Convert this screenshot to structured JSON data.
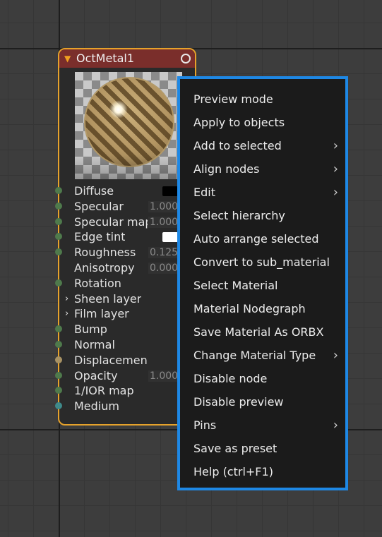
{
  "node": {
    "title": "OctMetal1",
    "pins": [
      {
        "label": "Diffuse",
        "dot": "green",
        "swatch": "#000000"
      },
      {
        "label": "Specular",
        "dot": "green",
        "value": "1.000"
      },
      {
        "label": "Specular map",
        "dot": "green",
        "value": "1.000"
      },
      {
        "label": "Edge tint",
        "dot": "green",
        "swatch": "#ffffff"
      },
      {
        "label": "Roughness",
        "dot": "green",
        "value": "0.125"
      },
      {
        "label": "Anisotropy",
        "dot": "none",
        "value": "0.000"
      },
      {
        "label": "Rotation",
        "dot": "green"
      },
      {
        "label": "Sheen layer",
        "dot": "none",
        "chevron": true
      },
      {
        "label": "Film layer",
        "dot": "none",
        "chevron": true
      },
      {
        "label": "Bump",
        "dot": "green"
      },
      {
        "label": "Normal",
        "dot": "green"
      },
      {
        "label": "Displacement",
        "dot": "tan"
      },
      {
        "label": "Opacity",
        "dot": "green",
        "value": "1.000"
      },
      {
        "label": "1/IOR map",
        "dot": "green"
      },
      {
        "label": "Medium",
        "dot": "teal"
      }
    ]
  },
  "context_menu": {
    "items": [
      {
        "label": "Preview mode"
      },
      {
        "label": "Apply to objects"
      },
      {
        "label": "Add to selected",
        "submenu": true
      },
      {
        "label": "Align nodes",
        "submenu": true
      },
      {
        "label": "Edit",
        "submenu": true
      },
      {
        "label": "Select hierarchy"
      },
      {
        "label": "Auto arrange selected"
      },
      {
        "label": "Convert to sub_material"
      },
      {
        "label": "Select Material"
      },
      {
        "label": "Material Nodegraph"
      },
      {
        "label": "Save Material As ORBX"
      },
      {
        "label": "Change Material Type",
        "submenu": true
      },
      {
        "label": "Disable node"
      },
      {
        "label": "Disable preview"
      },
      {
        "label": "Pins",
        "submenu": true
      },
      {
        "label": "Save as preset"
      },
      {
        "label": "Help (ctrl+F1)"
      }
    ],
    "submenu_arrow": "›"
  },
  "colors": {
    "node_border": "#e6a22b",
    "node_header": "#7a2e2b",
    "menu_border": "#1e88e5",
    "menu_background": "#1b1b1b"
  }
}
